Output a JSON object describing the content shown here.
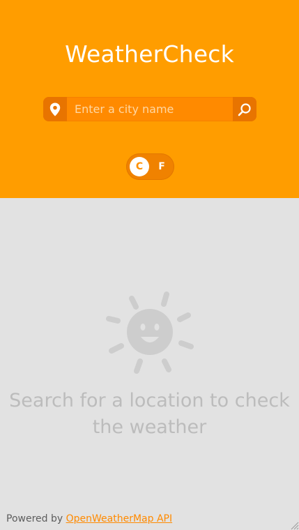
{
  "app": {
    "title": "WeatherCheck"
  },
  "search": {
    "placeholder": "Enter a city name",
    "value": ""
  },
  "units": {
    "celsius_label": "C",
    "fahrenheit_label": "F",
    "selected": "C"
  },
  "empty_state": {
    "icon": "sun-face-icon",
    "message": "Search for a location to check the weather"
  },
  "footer": {
    "prefix": "Powered by",
    "link_text": "OpenWeatherMap API"
  },
  "icons": {
    "location": "location-pin-icon",
    "search": "magnifier-icon"
  },
  "colors": {
    "accent": "#ff9d00",
    "accent_dark": "#e87400",
    "background": "#e2e2e2",
    "muted_text": "#bcbcbc",
    "link": "#ff8a00"
  }
}
